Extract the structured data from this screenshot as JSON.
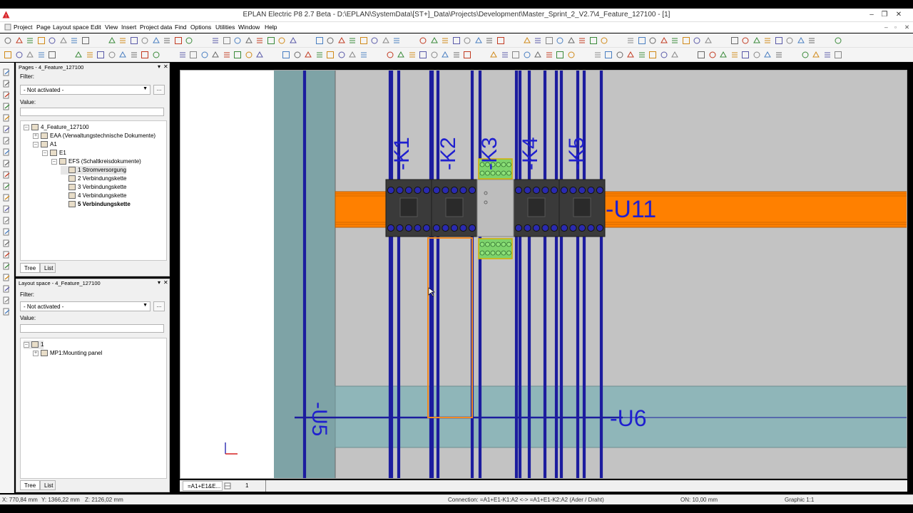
{
  "window": {
    "title": "EPLAN Electric P8 2.7 Beta - D:\\EPLAN\\SystemData\\[ST+]_Data\\Projects\\Development\\Master_Sprint_2_V2.7\\4_Feature_127100 - [1]",
    "minimize": "–",
    "restore": "❐",
    "close": "✕"
  },
  "menu": [
    "Project",
    "Page",
    "Layout space",
    "Edit",
    "View",
    "Insert",
    "Project data",
    "Find",
    "Options",
    "Utilities",
    "Window",
    "Help"
  ],
  "pages_panel": {
    "title": "Pages - 4_Feature_127100",
    "filter_label": "Filter:",
    "filter_value": "- Not activated -",
    "dots": "...",
    "value_label": "Value:",
    "tree": [
      {
        "label": "4_Feature_127100",
        "level": 0,
        "expander": "–"
      },
      {
        "label": "EAA (Verwaltungstechnische Dokumente)",
        "level": 1,
        "expander": "+"
      },
      {
        "label": "A1",
        "level": 1,
        "expander": "–"
      },
      {
        "label": "E1",
        "level": 2,
        "expander": "–"
      },
      {
        "label": "EFS (Schaltkreisdokumente)",
        "level": 3,
        "expander": "–"
      },
      {
        "label": "1 Stromversorgung",
        "level": 4,
        "selected": true
      },
      {
        "label": "2 Verbindungskette",
        "level": 4
      },
      {
        "label": "3 Verbindungskette",
        "level": 4
      },
      {
        "label": "4 Verbindungskette",
        "level": 4
      },
      {
        "label": "5 Verbindungskette",
        "level": 4,
        "bold": true
      }
    ],
    "tabs": [
      "Tree",
      "List"
    ]
  },
  "layout_panel": {
    "title": "Layout space - 4_Feature_127100",
    "filter_label": "Filter:",
    "filter_value": "- Not activated -",
    "dots": "...",
    "value_label": "Value:",
    "tree": [
      {
        "label": "1",
        "level": 0,
        "expander": "–",
        "selected": true
      },
      {
        "label": "MP1:Mounting panel",
        "level": 1,
        "expander": "+"
      }
    ],
    "tabs": [
      "Tree",
      "List"
    ]
  },
  "canvas": {
    "device_labels": [
      "-K1",
      "-K2",
      "-K3",
      "-K4",
      "-K5"
    ],
    "rail_label": "-U11",
    "duct_label": "-U6",
    "left_label": "-U5",
    "colors": {
      "wire": "#1c1c9e",
      "rail": "#ff8000",
      "panel": "#c3c3c3",
      "duct": "#8fb6b9",
      "left_duct": "#7ea3a6",
      "contactor": "#3a3a3a",
      "terminal": "#7dd36b",
      "highlight": "#f08a24"
    }
  },
  "canvas_tabs": [
    "=A1+E1&E...",
    "1"
  ],
  "status": {
    "x": "X: 770,84 mm",
    "y": "Y: 1366,22 mm",
    "z": "Z: 2126,02 mm",
    "connection": "Connection: =A1+E1-K1:A2 <-> =A1+E1-K2:A2 (Ader / Draht)",
    "on": "ON: 10,00 mm",
    "graphic": "Graphic 1:1"
  }
}
